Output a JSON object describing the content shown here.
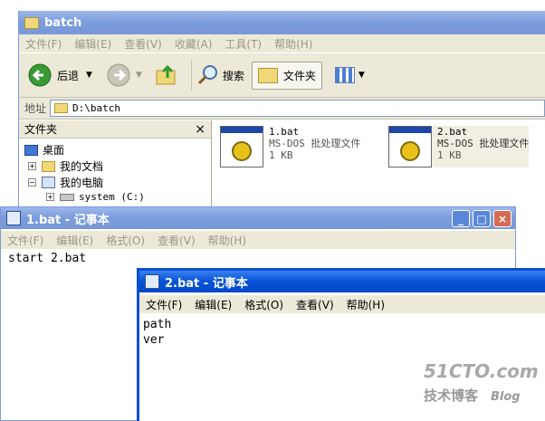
{
  "explorer": {
    "title": "batch",
    "menu": [
      "文件(F)",
      "编辑(E)",
      "查看(V)",
      "收藏(A)",
      "工具(T)",
      "帮助(H)"
    ],
    "toolbar": {
      "back": "后退",
      "search": "搜索",
      "folders": "文件夹"
    },
    "address": {
      "label": "地址",
      "value": "D:\\batch"
    },
    "folder_pane": {
      "title": "文件夹",
      "close": "×",
      "items": [
        "桌面",
        "我的文档",
        "我的电脑",
        "system (C:)"
      ]
    },
    "files": [
      {
        "name": "1.bat",
        "type": "MS-DOS 批处理文件",
        "size": "1 KB"
      },
      {
        "name": "2.bat",
        "type": "MS-DOS 批处理文件",
        "size": "1 KB"
      }
    ]
  },
  "notepad1": {
    "title": "1.bat - 记事本",
    "menu": [
      "文件(F)",
      "编辑(E)",
      "格式(O)",
      "查看(V)",
      "帮助(H)"
    ],
    "lines": [
      "start 2.bat"
    ]
  },
  "notepad2": {
    "title": "2.bat - 记事本",
    "menu": [
      "文件(F)",
      "编辑(E)",
      "格式(O)",
      "查看(V)",
      "帮助(H)"
    ],
    "lines": [
      "path",
      "ver"
    ]
  },
  "watermark": {
    "brand": "51CTO.com",
    "sub": "技术博客",
    "blog": "Blog"
  }
}
